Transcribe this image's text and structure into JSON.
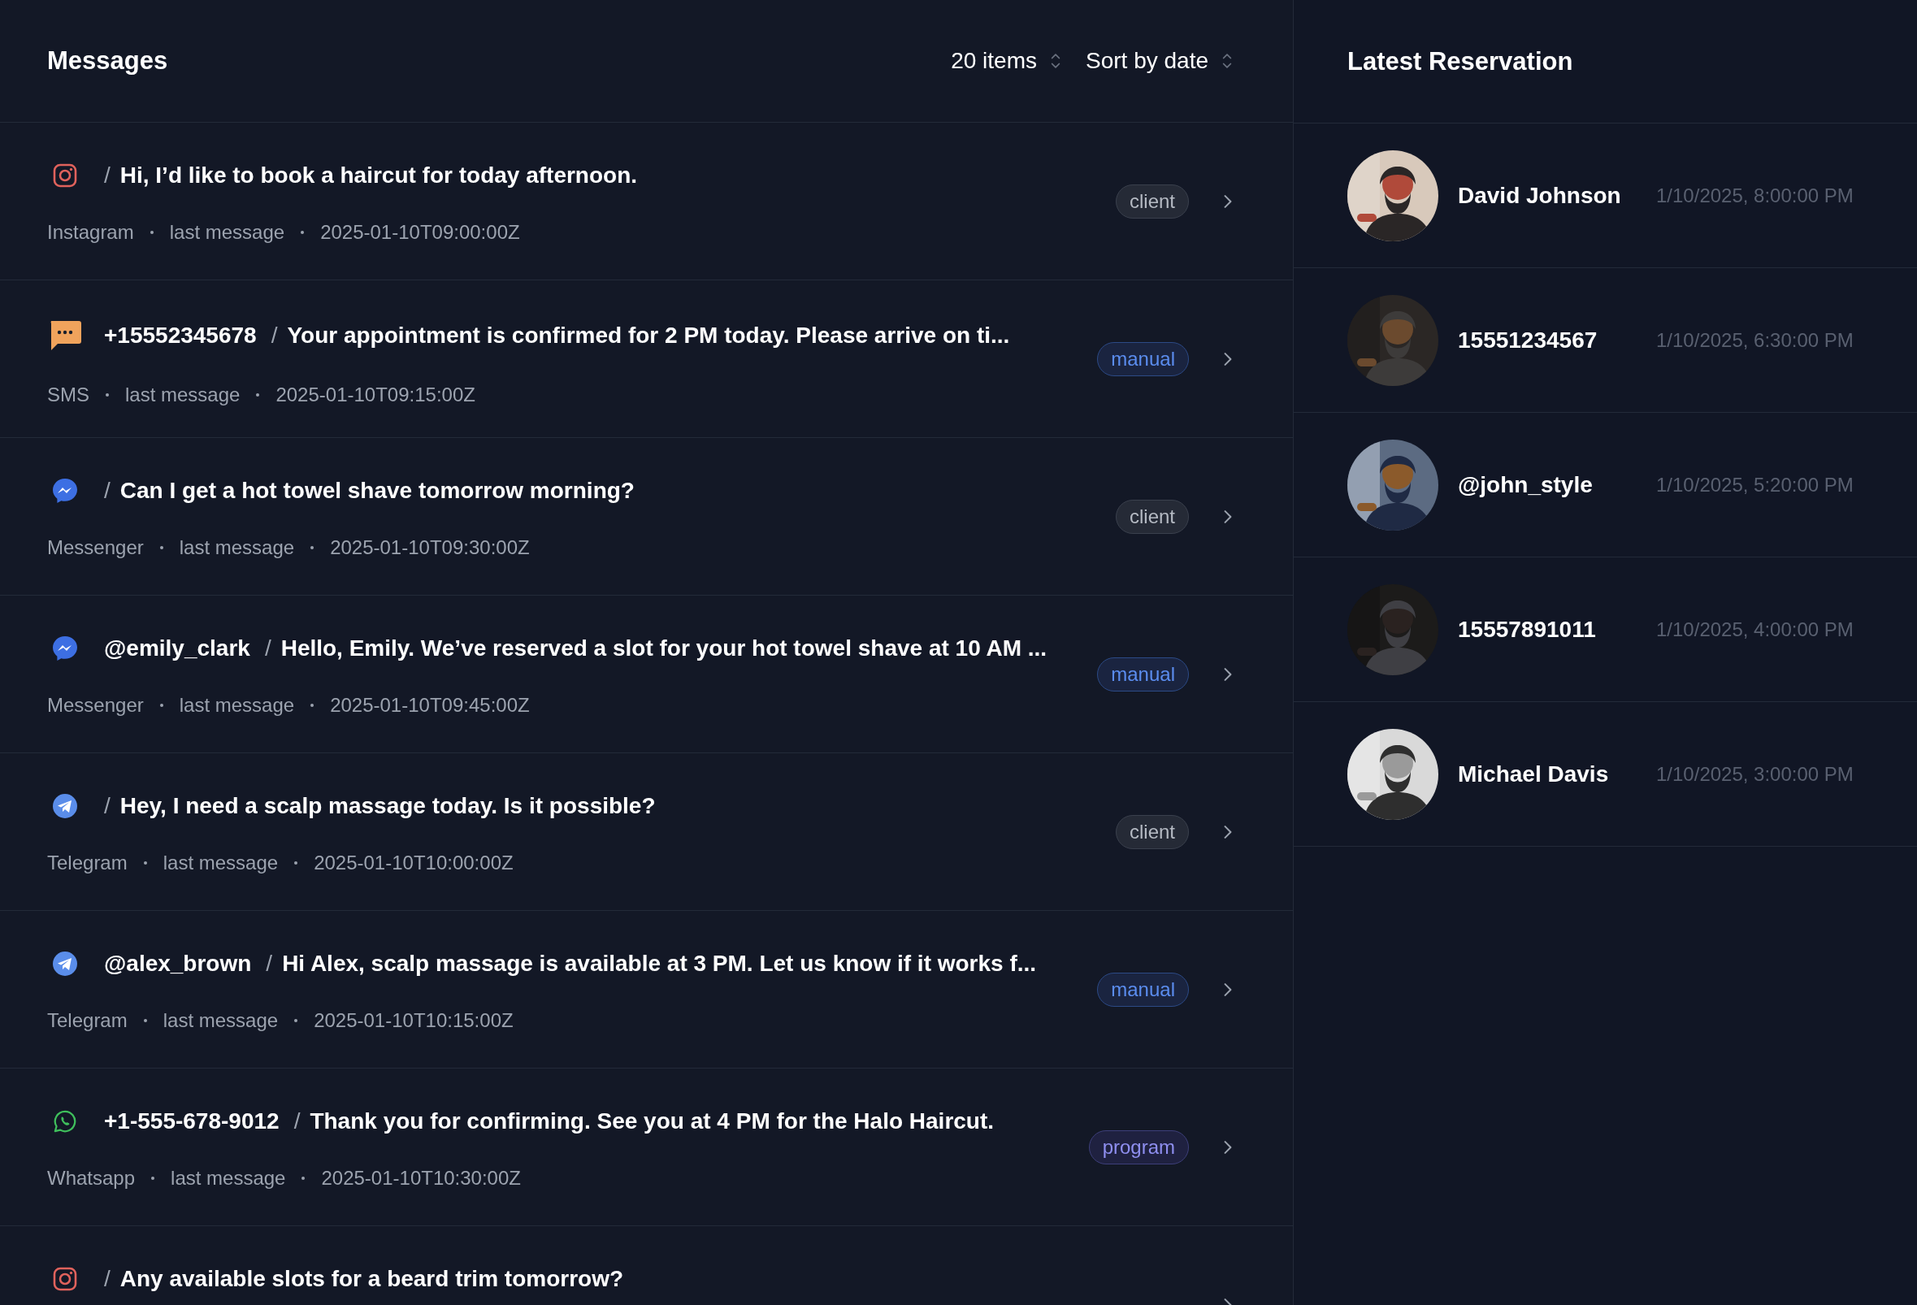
{
  "messages_panel": {
    "title": "Messages",
    "item_count": "20 items",
    "sort": "Sort by date"
  },
  "messages": [
    {
      "kind": "instagram",
      "separator": "/",
      "text": "Hi, I’d like to book a haircut for today afternoon.",
      "channel": "Instagram",
      "meta_label": "last message",
      "time": "2025-01-10T09:00:00Z",
      "badge": {
        "kind": "client",
        "label": "client"
      }
    },
    {
      "kind": "sms",
      "sender": "+15552345678",
      "separator": "/",
      "text": "Your appointment is confirmed for 2 PM today. Please arrive on ti...",
      "channel": "SMS",
      "meta_label": "last message",
      "time": "2025-01-10T09:15:00Z",
      "badge": {
        "kind": "manual",
        "label": "manual"
      }
    },
    {
      "kind": "messenger",
      "separator": "/",
      "text": "Can I get a hot towel shave tomorrow morning?",
      "channel": "Messenger",
      "meta_label": "last message",
      "time": "2025-01-10T09:30:00Z",
      "badge": {
        "kind": "client",
        "label": "client"
      }
    },
    {
      "kind": "messenger",
      "sender": "@emily_clark",
      "separator": "/",
      "text": "Hello, Emily. We’ve reserved a slot for your hot towel shave at 10 AM ...",
      "channel": "Messenger",
      "meta_label": "last message",
      "time": "2025-01-10T09:45:00Z",
      "badge": {
        "kind": "manual",
        "label": "manual"
      }
    },
    {
      "kind": "telegram",
      "separator": "/",
      "text": "Hey, I need a scalp massage today. Is it possible?",
      "channel": "Telegram",
      "meta_label": "last message",
      "time": "2025-01-10T10:00:00Z",
      "badge": {
        "kind": "client",
        "label": "client"
      }
    },
    {
      "kind": "telegram",
      "sender": "@alex_brown",
      "separator": "/",
      "text": "Hi Alex, scalp massage is available at 3 PM. Let us know if it works f...",
      "channel": "Telegram",
      "meta_label": "last message",
      "time": "2025-01-10T10:15:00Z",
      "badge": {
        "kind": "manual",
        "label": "manual"
      }
    },
    {
      "kind": "whatsapp",
      "sender": "+1-555-678-9012",
      "separator": "/",
      "text": "Thank you for confirming. See you at 4 PM for the Halo Haircut.",
      "channel": "Whatsapp",
      "meta_label": "last message",
      "time": "2025-01-10T10:30:00Z",
      "badge": {
        "kind": "program",
        "label": "program"
      }
    },
    {
      "kind": "instagram",
      "separator": "/",
      "text": "Any available slots for a beard trim tomorrow?"
    }
  ],
  "reservations_panel": {
    "title": "Latest Reservation"
  },
  "reservations": [
    {
      "name": "David Johnson",
      "time": "1/10/2025, 8:00:00 PM"
    },
    {
      "name": "15551234567",
      "time": "1/10/2025, 6:30:00 PM"
    },
    {
      "name": "@john_style",
      "time": "1/10/2025, 5:20:00 PM"
    },
    {
      "name": "15557891011",
      "time": "1/10/2025, 4:00:00 PM"
    },
    {
      "name": "Michael Davis",
      "time": "1/10/2025, 3:00:00 PM"
    }
  ]
}
